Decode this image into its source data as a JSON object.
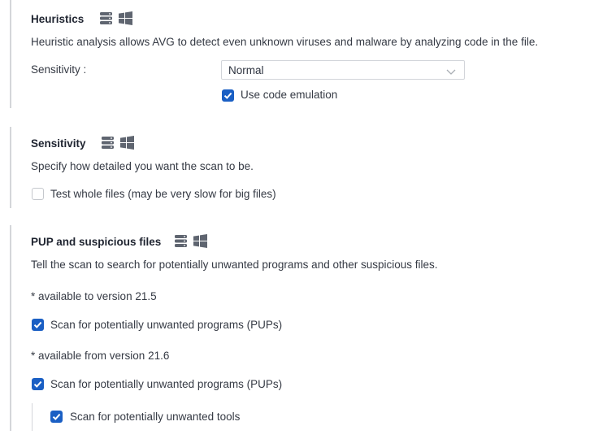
{
  "heuristics": {
    "title": "Heuristics",
    "icons": [
      "server-stack-icon",
      "windows-logo-icon"
    ],
    "description": "Heuristic analysis allows AVG to detect even unknown viruses and malware by analyzing code in the file.",
    "sensitivity_label": "Sensitivity :",
    "sensitivity_value": "Normal",
    "code_emulation": {
      "label": "Use code emulation",
      "checked": true
    }
  },
  "sensitivity": {
    "title": "Sensitivity",
    "icons": [
      "server-stack-icon",
      "windows-logo-icon"
    ],
    "description": "Specify how detailed you want the scan to be.",
    "whole_files": {
      "label": "Test whole files (may be very slow for big files)",
      "checked": false
    }
  },
  "pup": {
    "title": "PUP and suspicious files",
    "icons": [
      "server-stack-icon",
      "windows-logo-icon"
    ],
    "description": "Tell the scan to search for potentially unwanted programs and other suspicious files.",
    "note_to": "* available to version 21.5",
    "pups_old": {
      "label": "Scan for potentially unwanted programs (PUPs)",
      "checked": true
    },
    "note_from": "* available from version 21.6",
    "pups_new": {
      "label": "Scan for potentially unwanted programs (PUPs)",
      "checked": true
    },
    "tools": {
      "label": "Scan for potentially unwanted tools",
      "checked": true
    }
  },
  "colors": {
    "accent": "#1a5fc4",
    "icon": "#5f6570",
    "rule": "#d4d6da"
  }
}
